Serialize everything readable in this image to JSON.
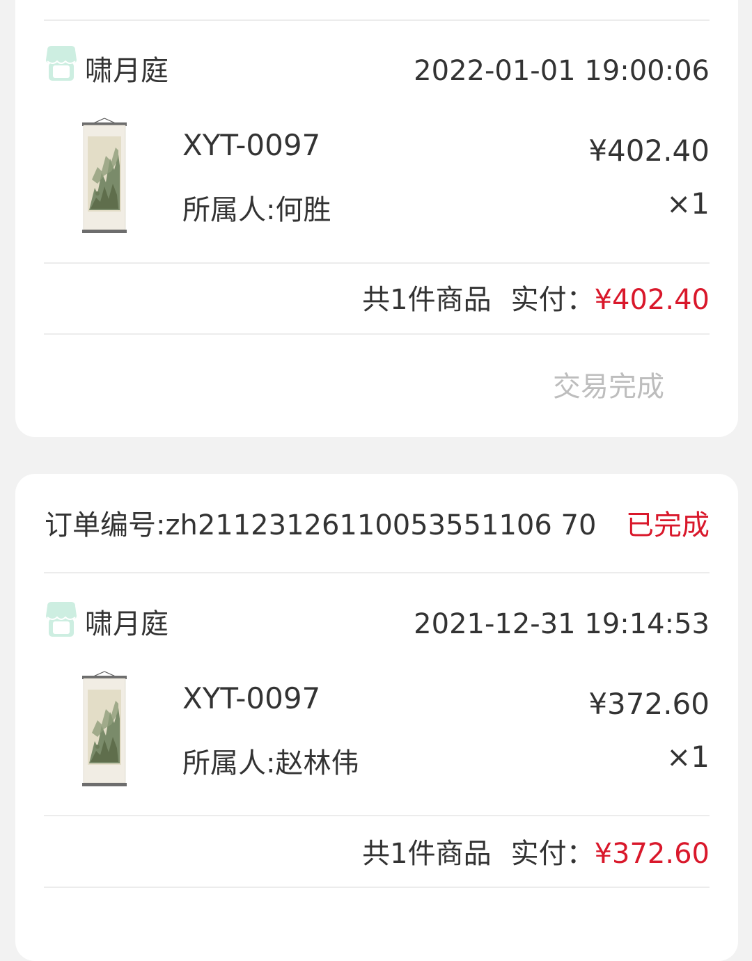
{
  "orders": [
    {
      "shop_name": "啸月庭",
      "time": "2022-01-01 19:00:06",
      "product": {
        "name": "XYT-0097",
        "owner": "所属人:何胜",
        "unit_price": "¥402.40",
        "quantity": "×1"
      },
      "summary": {
        "count_text": "共1件商品",
        "paid_label": "实付：",
        "total": "¥402.40"
      },
      "status_text": "交易完成"
    },
    {
      "order_no": "订单编号:zh21123126110053551106 70",
      "order_status": "已完成",
      "shop_name": "啸月庭",
      "time": "2021-12-31 19:14:53",
      "product": {
        "name": "XYT-0097",
        "owner": "所属人:赵林伟",
        "unit_price": "¥372.60",
        "quantity": "×1"
      },
      "summary": {
        "count_text": "共1件商品",
        "paid_label": "实付：",
        "total": "¥372.60"
      }
    }
  ],
  "colors": {
    "accent_red": "#d9182b",
    "shop_icon_green": "#bfe8d8",
    "muted_status": "#bdbdbd",
    "background": "#f2f2f2"
  },
  "icons": {
    "shop": "shop-icon",
    "product": "scroll-painting-thumbnail"
  }
}
